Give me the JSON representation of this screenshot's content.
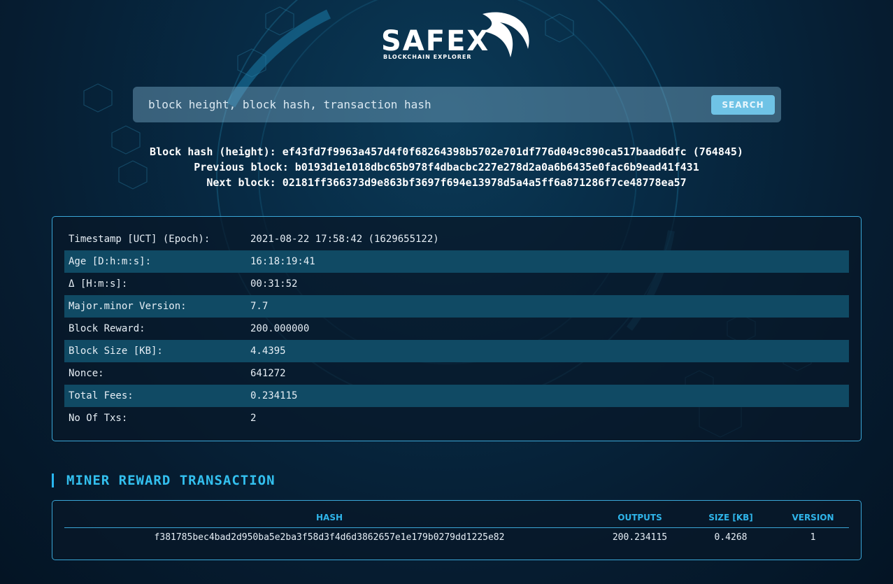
{
  "brand": {
    "name": "SAFEX",
    "subtitle": "BLOCKCHAIN EXPLORER"
  },
  "search": {
    "placeholder": "block height, block hash, transaction hash",
    "button_label": "SEARCH"
  },
  "block": {
    "hash_label": "Block hash (height):",
    "hash": "ef43fd7f9963a457d4f0f68264398b5702e701df776d049c890ca517baad6dfc",
    "height": "(764845)",
    "previous_label": "Previous block:",
    "previous": "b0193d1e1018dbc65b978f4dbacbc227e278d2a0a6b6435e0fac6b9ead41f431",
    "next_label": "Next block:",
    "next": "02181ff366373d9e863bf3697f694e13978d5a4a5ff6a871286f7ce48778ea57"
  },
  "details": [
    {
      "label": "Timestamp [UCT] (Epoch):",
      "value": "2021-08-22 17:58:42 (1629655122)"
    },
    {
      "label": "Age [D:h:m:s]:",
      "value": "16:18:19:41"
    },
    {
      "label": "Δ [H:m:s]:",
      "value": "00:31:52"
    },
    {
      "label": "Major.minor Version:",
      "value": "7.7"
    },
    {
      "label": "Block Reward:",
      "value": "200.000000"
    },
    {
      "label": "Block Size [KB]:",
      "value": "4.4395"
    },
    {
      "label": "Nonce:",
      "value": "641272"
    },
    {
      "label": "Total Fees:",
      "value": "0.234115"
    },
    {
      "label": "No Of Txs:",
      "value": "2"
    }
  ],
  "miner_tx": {
    "title": "MINER REWARD TRANSACTION",
    "columns": [
      "HASH",
      "OUTPUTS",
      "SIZE [KB]",
      "VERSION"
    ],
    "rows": [
      {
        "hash": "f381785bec4bad2d950ba5e2ba3f58d3f4d6d3862657e1e179b0279dd1225e82",
        "outputs": "200.234115",
        "size": "0.4268",
        "version": "1"
      }
    ]
  },
  "colors": {
    "accent": "#33c0ef",
    "row_alt": "#104a64",
    "border": "#3aa6d6",
    "button": "#6fc3e6"
  }
}
